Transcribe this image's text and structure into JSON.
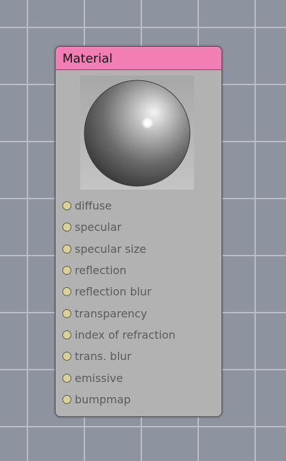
{
  "node": {
    "title": "Material",
    "header_color": "#f27fb4",
    "preview": {
      "name": "sphere-preview"
    },
    "inputs": [
      {
        "label": "diffuse"
      },
      {
        "label": "specular"
      },
      {
        "label": "specular size"
      },
      {
        "label": "reflection"
      },
      {
        "label": "reflection blur"
      },
      {
        "label": "transparency"
      },
      {
        "label": "index of refraction"
      },
      {
        "label": "trans. blur"
      },
      {
        "label": "emissive"
      },
      {
        "label": "bumpmap"
      }
    ]
  }
}
